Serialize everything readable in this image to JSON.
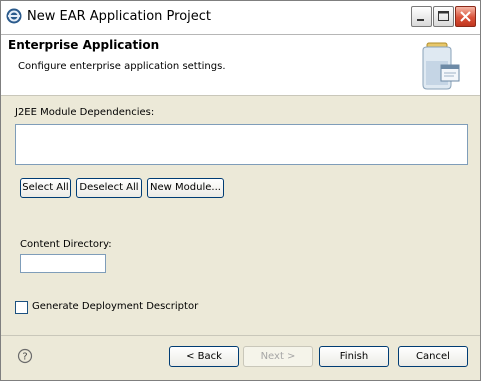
{
  "window": {
    "title": "New EAR Application Project",
    "minimize_icon": "minimize-icon",
    "maximize_icon": "maximize-icon",
    "close_icon": "close-icon"
  },
  "banner": {
    "title": "Enterprise Application",
    "description": "Configure enterprise application settings.",
    "image_icon": "ear-wizard-icon"
  },
  "modules": {
    "label": "J2EE Module Dependencies:",
    "items": []
  },
  "buttons": {
    "select_all": "Select All",
    "deselect_all": "Deselect All",
    "new_module": "New Module..."
  },
  "content_dir": {
    "label": "Content Directory:",
    "value": ""
  },
  "generate_descriptor": {
    "label": "Generate Deployment Descriptor",
    "checked": false
  },
  "footer": {
    "help_icon": "help-icon",
    "back": "< Back",
    "next": "Next >",
    "finish": "Finish",
    "cancel": "Cancel"
  },
  "colors": {
    "dialog_bg": "#ece9d8",
    "button_border": "#003c74",
    "field_border": "#7f9db9",
    "close_red": "#d9523a"
  }
}
